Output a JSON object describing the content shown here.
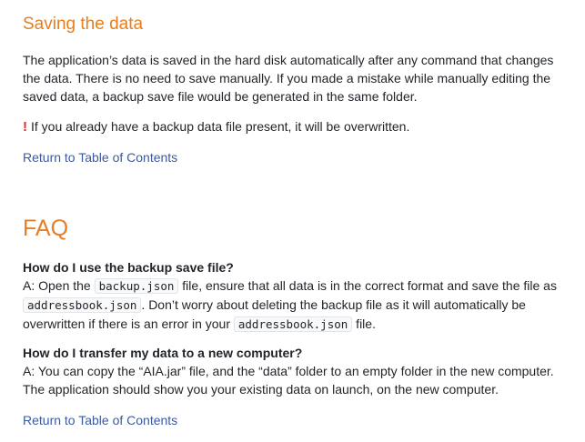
{
  "saving": {
    "title": "Saving the data",
    "para_line1": "The application’s data is saved in the hard disk automatically after any command that changes",
    "para_line2": "the data. There is no need to save manually. If you made a mistake while manually editing the",
    "para_line3": "saved data, a backup save file would be generated in the same folder.",
    "warning_icon": "!",
    "warning_text": "If you already have a backup data file present, it will be overwritten.",
    "toc_link": "Return to Table of Contents"
  },
  "faq": {
    "title": "FAQ",
    "q1": {
      "question": "How do I use the backup save file?",
      "a_line1_pre": "A: Open the ",
      "a_line1_code": "backup.json",
      "a_line1_post": " file, ensure that all data is in the correct format and save the file as",
      "a_line2_code": "addressbook.json",
      "a_line2_post": ". Don’t worry about deleting the backup file as it will automatically be",
      "a_line3_pre": "overwritten if there is an error in your ",
      "a_line3_code": "addressbook.json",
      "a_line3_post": " file."
    },
    "q2": {
      "question": "How do I transfer my data to a new computer?",
      "a_line1": "A: You can copy the “AIA.jar” file, and the “data” folder to an empty folder in the new computer.",
      "a_line2": "The application should show you your existing data on launch, on the new computer."
    },
    "toc_link": "Return to Table of Contents"
  },
  "colors": {
    "heading": "#e67e22",
    "link": "#3a5ba0",
    "warning": "#e0292b",
    "text": "#212529"
  }
}
